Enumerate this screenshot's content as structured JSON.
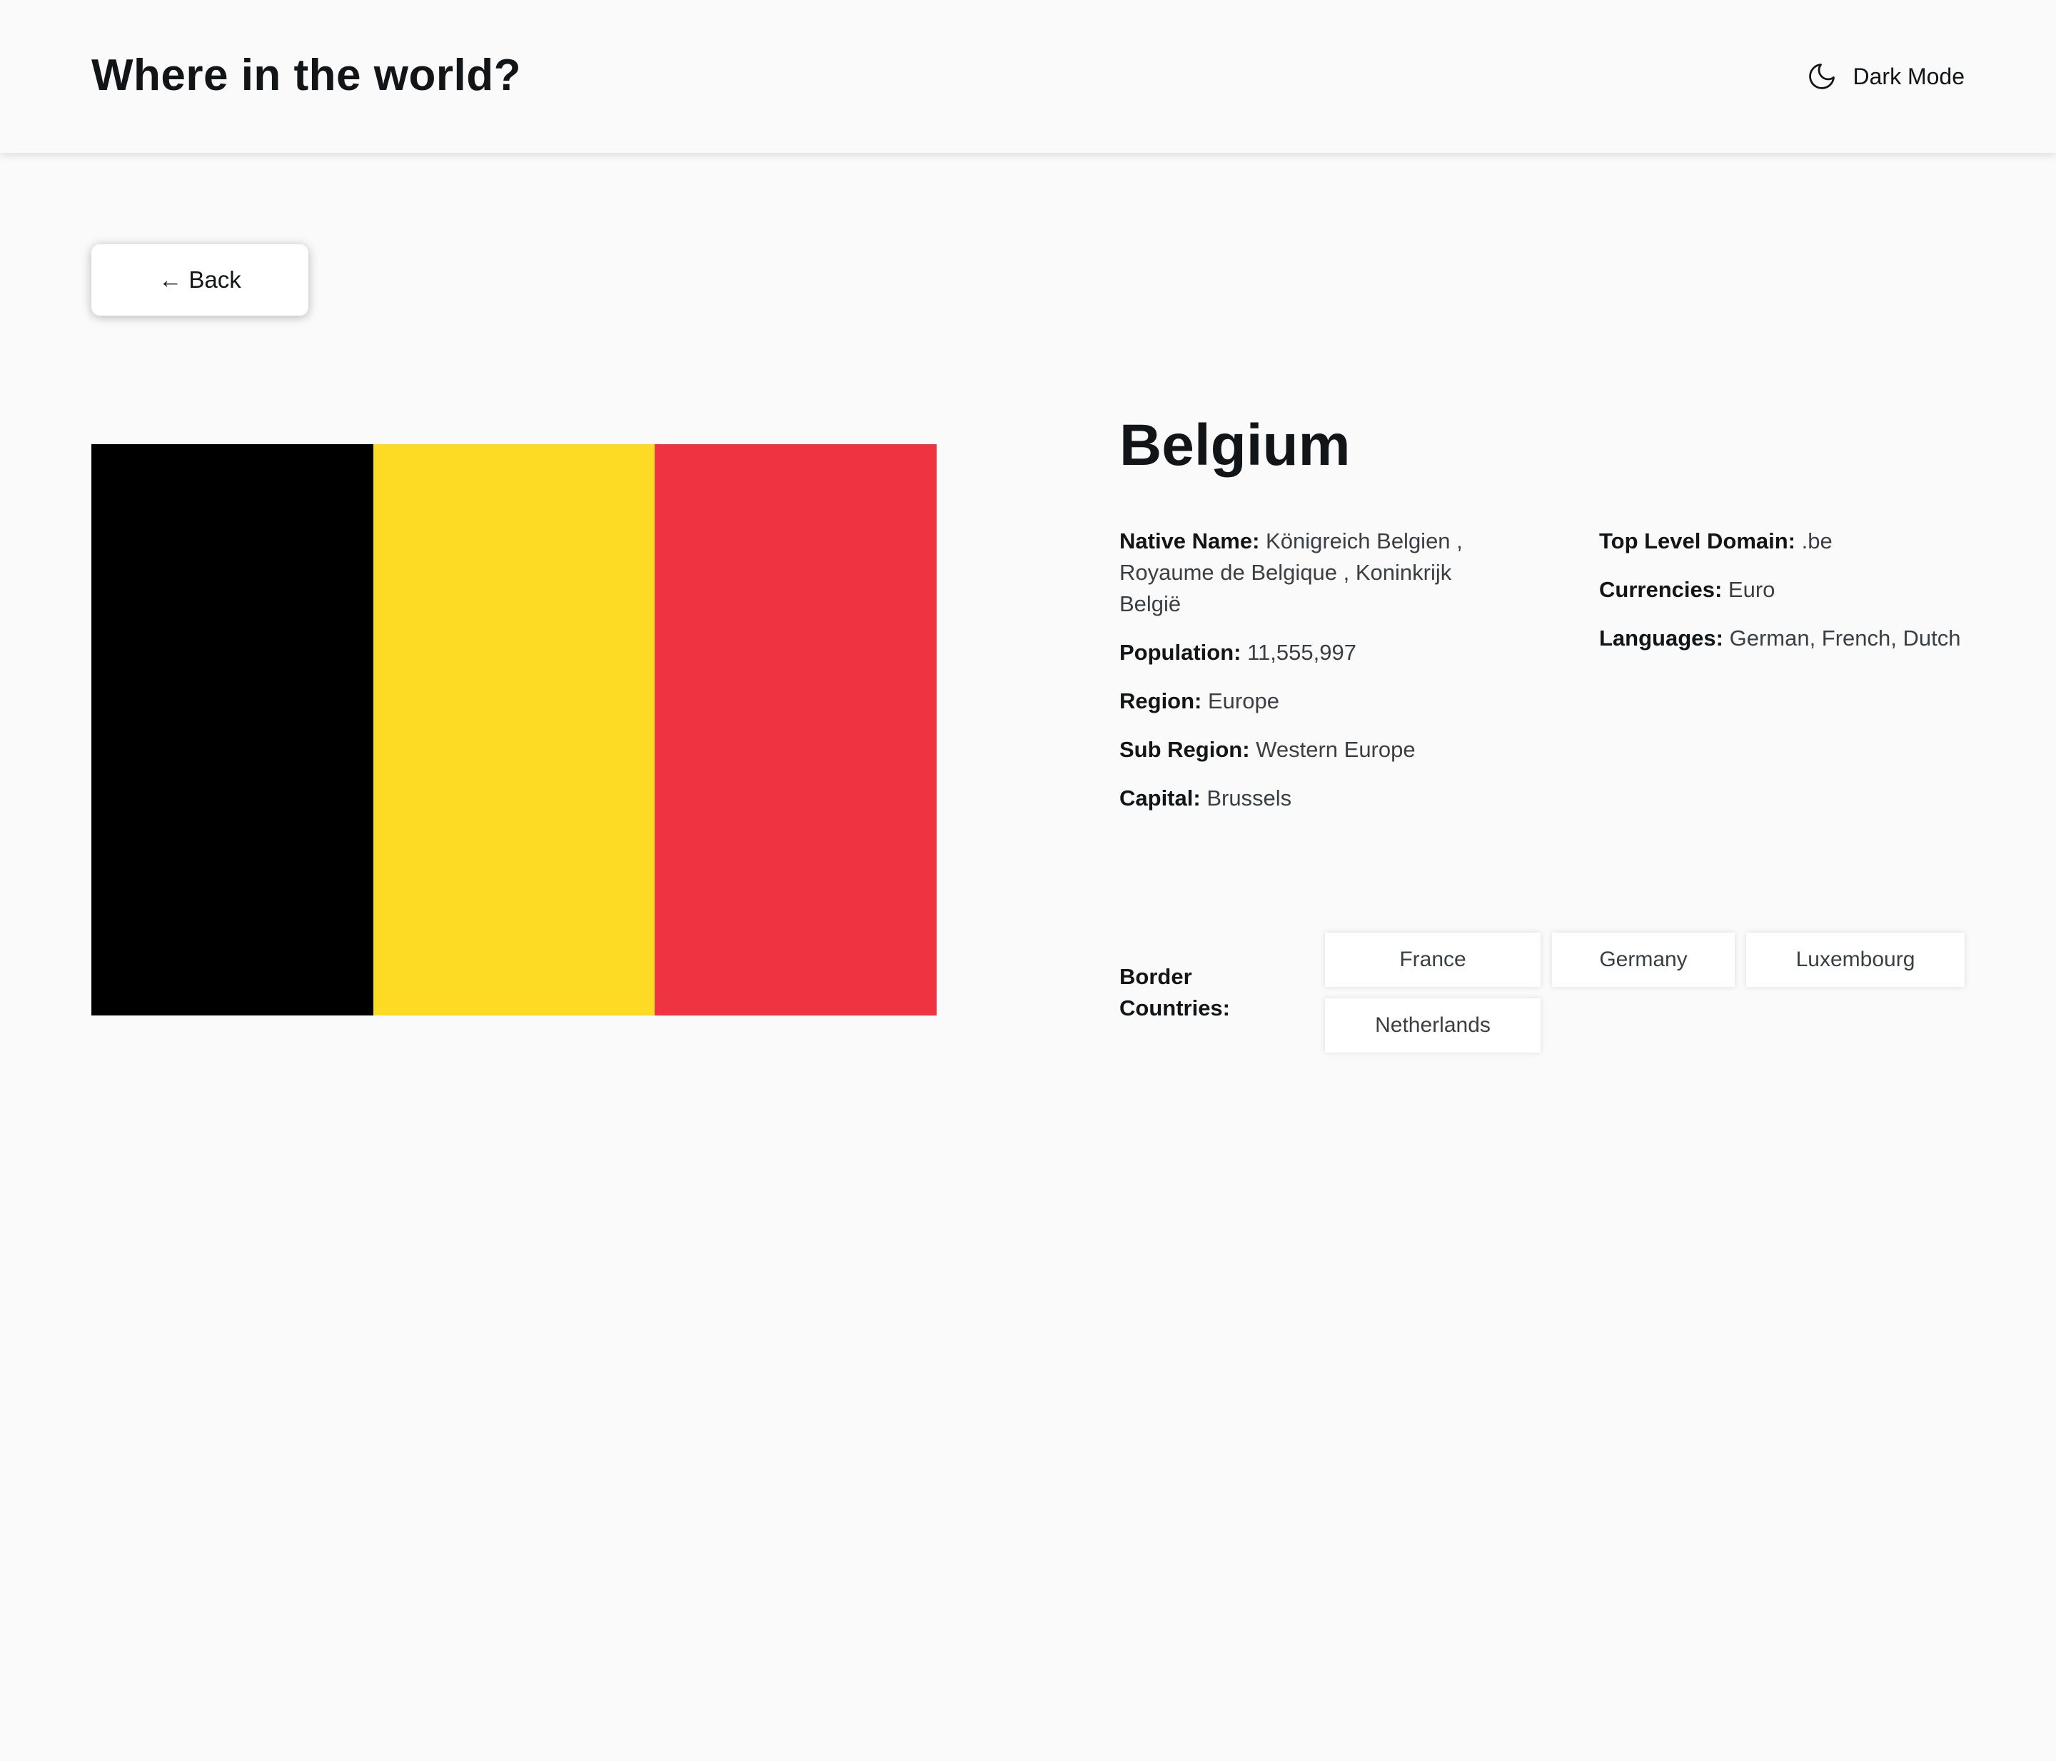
{
  "header": {
    "title": "Where in the world?",
    "theme_toggle_label": "Dark Mode",
    "theme_toggle_icon": "moon-icon"
  },
  "back_button": {
    "label": "← Back",
    "icon": "arrow-left-icon"
  },
  "country": {
    "name": "Belgium",
    "flag": {
      "stripes": [
        "#000000",
        "#FDDA24",
        "#EF3340"
      ]
    },
    "left_column": [
      {
        "label": "Native Name:",
        "value": "Königreich Belgien , Royaume de Belgique , Koninkrijk België"
      },
      {
        "label": "Population:",
        "value": "11,555,997"
      },
      {
        "label": "Region:",
        "value": "Europe"
      },
      {
        "label": "Sub Region:",
        "value": "Western Europe"
      },
      {
        "label": "Capital:",
        "value": "Brussels"
      }
    ],
    "right_column": [
      {
        "label": "Top Level Domain:",
        "value": ".be"
      },
      {
        "label": "Currencies:",
        "value": "Euro"
      },
      {
        "label": "Languages:",
        "value": "German, French, Dutch"
      }
    ],
    "border_countries_label": "Border Countries:",
    "border_countries": [
      "France",
      "Germany",
      "Luxembourg",
      "Netherlands"
    ]
  },
  "colors": {
    "background": "#fafafa",
    "element": "#ffffff",
    "text": "#111517"
  }
}
